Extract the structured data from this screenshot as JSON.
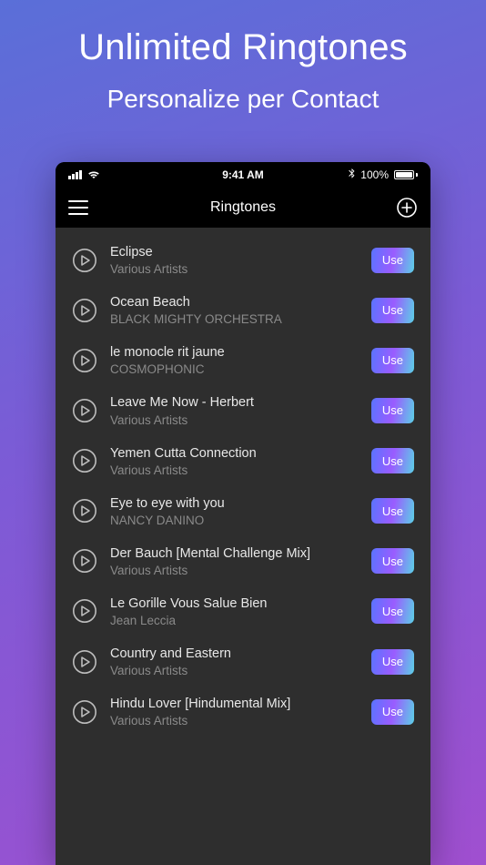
{
  "promo": {
    "title": "Unlimited Ringtones",
    "subtitle": "Personalize per Contact"
  },
  "status": {
    "time": "9:41 AM",
    "battery_percent": "100%",
    "bt_glyph": "✻"
  },
  "nav": {
    "title": "Ringtones"
  },
  "use_label": "Use",
  "ringtones": [
    {
      "title": "Eclipse",
      "artist": "Various Artists"
    },
    {
      "title": "Ocean Beach",
      "artist": "BLACK MIGHTY ORCHESTRA"
    },
    {
      "title": "le monocle rit jaune",
      "artist": "COSMOPHONIC"
    },
    {
      "title": "Leave Me Now - Herbert",
      "artist": "Various Artists"
    },
    {
      "title": "Yemen Cutta Connection",
      "artist": "Various Artists"
    },
    {
      "title": "Eye to eye with you",
      "artist": "NANCY DANINO"
    },
    {
      "title": "Der Bauch [Mental Challenge Mix]",
      "artist": "Various Artists"
    },
    {
      "title": "Le Gorille Vous Salue Bien",
      "artist": "Jean Leccia"
    },
    {
      "title": "Country and Eastern",
      "artist": "Various Artists"
    },
    {
      "title": "Hindu Lover [Hindumental Mix]",
      "artist": "Various Artists"
    }
  ]
}
